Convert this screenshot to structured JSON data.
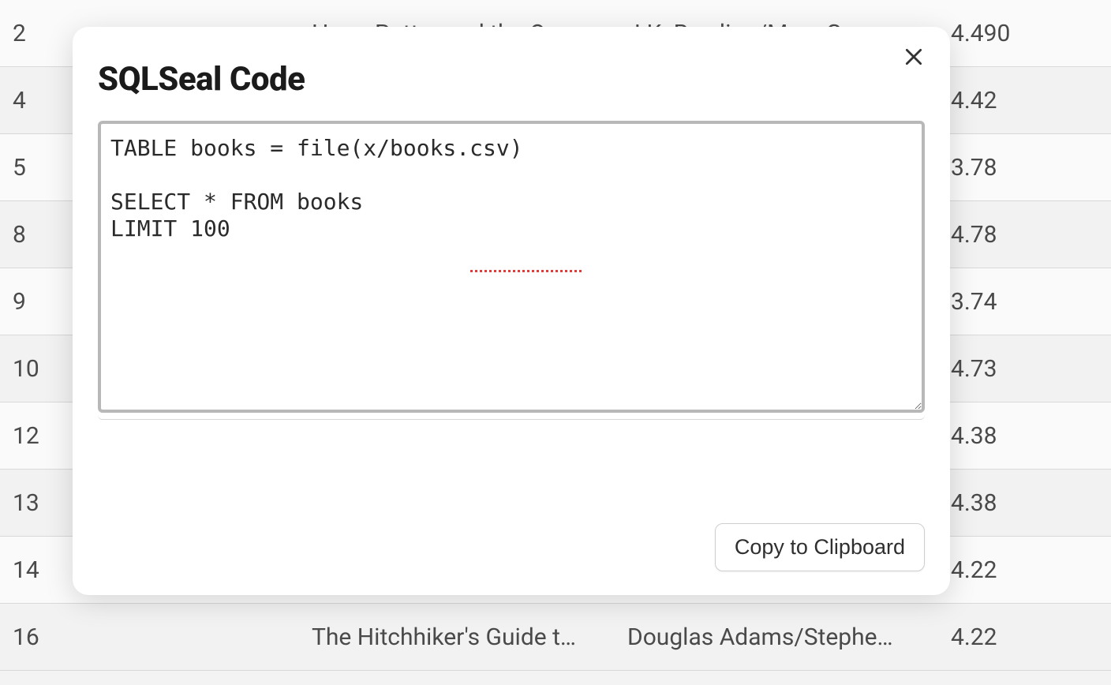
{
  "modal": {
    "title": "SQLSeal Code",
    "code": "TABLE books = file(x/books.csv)\n\nSELECT * FROM books\nLIMIT 100",
    "copy_button_label": "Copy to Clipboard",
    "close_icon_title": "Close"
  },
  "background_table": {
    "rows": [
      {
        "idx": "2",
        "title": "Harry Potter and the Or…",
        "author": "J.K. Rowling/Mary Gran…",
        "rating": "4.490"
      },
      {
        "idx": "4",
        "title": "",
        "author": "",
        "rating": "4.42"
      },
      {
        "idx": "5",
        "title": "",
        "author": "",
        "rating": "3.78"
      },
      {
        "idx": "8",
        "title": "",
        "author": "",
        "rating": "4.78"
      },
      {
        "idx": "9",
        "title": "",
        "author": "",
        "rating": "3.74"
      },
      {
        "idx": "10",
        "title": "",
        "author": "",
        "rating": "4.73"
      },
      {
        "idx": "12",
        "title": "",
        "author": "",
        "rating": "4.38"
      },
      {
        "idx": "13",
        "title": "",
        "author": "",
        "rating": "4.38"
      },
      {
        "idx": "14",
        "title": "",
        "author": "",
        "rating": "4.22"
      },
      {
        "idx": "16",
        "title": "The Hitchhiker's Guide t…",
        "author": "Douglas Adams/Stephe…",
        "rating": "4.22"
      }
    ]
  }
}
